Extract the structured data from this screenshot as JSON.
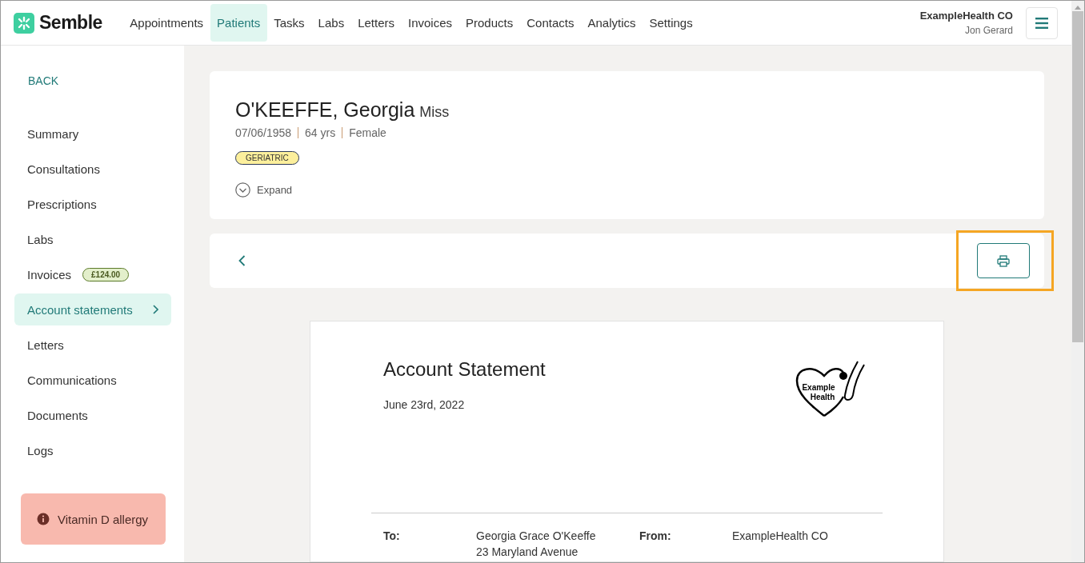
{
  "header": {
    "brand": "Semble",
    "nav": [
      {
        "label": "Appointments",
        "selected": false
      },
      {
        "label": "Patients",
        "selected": true
      },
      {
        "label": "Tasks",
        "selected": false
      },
      {
        "label": "Labs",
        "selected": false
      },
      {
        "label": "Letters",
        "selected": false
      },
      {
        "label": "Invoices",
        "selected": false
      },
      {
        "label": "Products",
        "selected": false
      },
      {
        "label": "Contacts",
        "selected": false
      },
      {
        "label": "Analytics",
        "selected": false
      },
      {
        "label": "Settings",
        "selected": false
      }
    ],
    "organisation": "ExampleHealth CO",
    "user": "Jon Gerard"
  },
  "sidebar": {
    "back": "BACK",
    "items": [
      {
        "label": "Summary",
        "selected": false
      },
      {
        "label": "Consultations",
        "selected": false
      },
      {
        "label": "Prescriptions",
        "selected": false
      },
      {
        "label": "Labs",
        "selected": false
      },
      {
        "label": "Invoices",
        "selected": false,
        "badge": "£124.00"
      },
      {
        "label": "Account statements",
        "selected": true
      },
      {
        "label": "Letters",
        "selected": false
      },
      {
        "label": "Communications",
        "selected": false
      },
      {
        "label": "Documents",
        "selected": false
      },
      {
        "label": "Logs",
        "selected": false
      }
    ],
    "alert": "Vitamin D allergy"
  },
  "patient": {
    "name": "O'KEEFFE, Georgia",
    "title": "Miss",
    "details": [
      "07/06/1958",
      "64 yrs",
      "Female"
    ],
    "tag": "GERIATRIC",
    "expand": "Expand",
    "expanded": false
  },
  "toolbar": {
    "print_highlighted": true
  },
  "statement": {
    "title": "Account Statement",
    "date": "June 23rd, 2022",
    "logo_text": [
      "Example",
      "Health"
    ],
    "to_label": "To:",
    "to_lines": [
      "Georgia Grace O'Keeffe",
      "23 Maryland Avenue"
    ],
    "from_label": "From:",
    "from_lines": [
      "ExampleHealth CO"
    ]
  }
}
